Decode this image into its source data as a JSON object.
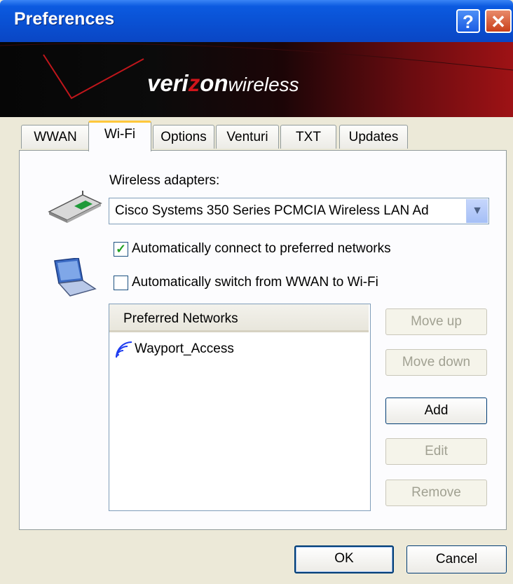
{
  "window": {
    "title": "Preferences",
    "help_glyph": "?",
    "close_glyph": "✕"
  },
  "banner": {
    "logo_bold": "veri",
    "logo_z": "z",
    "logo_on": "on",
    "logo_wireless": "wireless"
  },
  "tabs": [
    {
      "label": "WWAN"
    },
    {
      "label": "Wi-Fi"
    },
    {
      "label": "Options"
    },
    {
      "label": "Venturi"
    },
    {
      "label": "TXT"
    },
    {
      "label": "Updates"
    }
  ],
  "wifi": {
    "adapters_label": "Wireless adapters:",
    "adapter_value": "Cisco Systems 350 Series PCMCIA Wireless LAN Ad",
    "auto_connect_label": "Automatically connect to preferred networks",
    "auto_connect_checked": "✓",
    "auto_switch_label": "Automatically switch from WWAN to Wi-Fi",
    "preferred_header": "Preferred Networks",
    "networks": [
      "Wayport_Access"
    ],
    "move_up": "Move up",
    "move_down": "Move down",
    "add": "Add",
    "edit": "Edit",
    "remove": "Remove"
  },
  "footer": {
    "ok": "OK",
    "cancel": "Cancel"
  },
  "colors": {
    "titlebar": "#0a4fd1",
    "banner_red": "#9e1215",
    "active_tab_accent": "#ffc83c"
  }
}
